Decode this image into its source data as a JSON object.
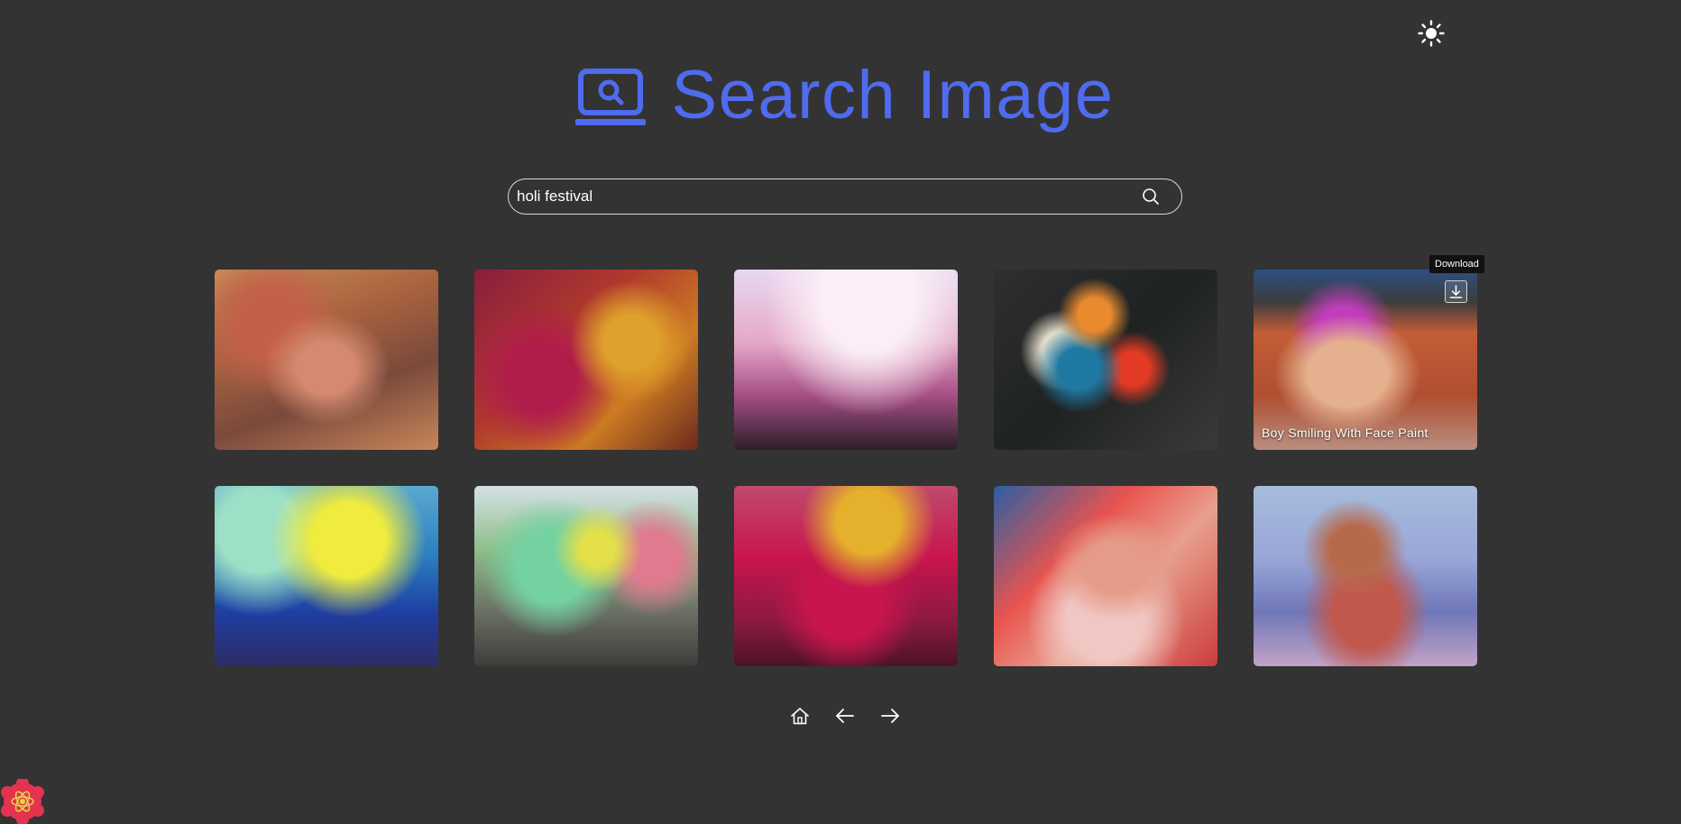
{
  "header": {
    "title": "Search Image",
    "logo_icon": "laptop-search-icon",
    "accent_color": "#4f6bef"
  },
  "theme_toggle": {
    "icon": "sun-icon"
  },
  "search": {
    "value": "holi festival",
    "placeholder": "",
    "icon": "search-icon"
  },
  "results": [
    {
      "caption": ""
    },
    {
      "caption": ""
    },
    {
      "caption": ""
    },
    {
      "caption": ""
    },
    {
      "caption": "Boy Smiling With Face Paint",
      "tooltip": "Download",
      "download_icon": "download-icon"
    },
    {
      "caption": ""
    },
    {
      "caption": ""
    },
    {
      "caption": ""
    },
    {
      "caption": ""
    },
    {
      "caption": ""
    }
  ],
  "pagination": {
    "home_icon": "home-icon",
    "prev_icon": "arrow-left-icon",
    "next_icon": "arrow-right-icon"
  },
  "colors": {
    "background": "#333333",
    "text": "#ffffff"
  }
}
